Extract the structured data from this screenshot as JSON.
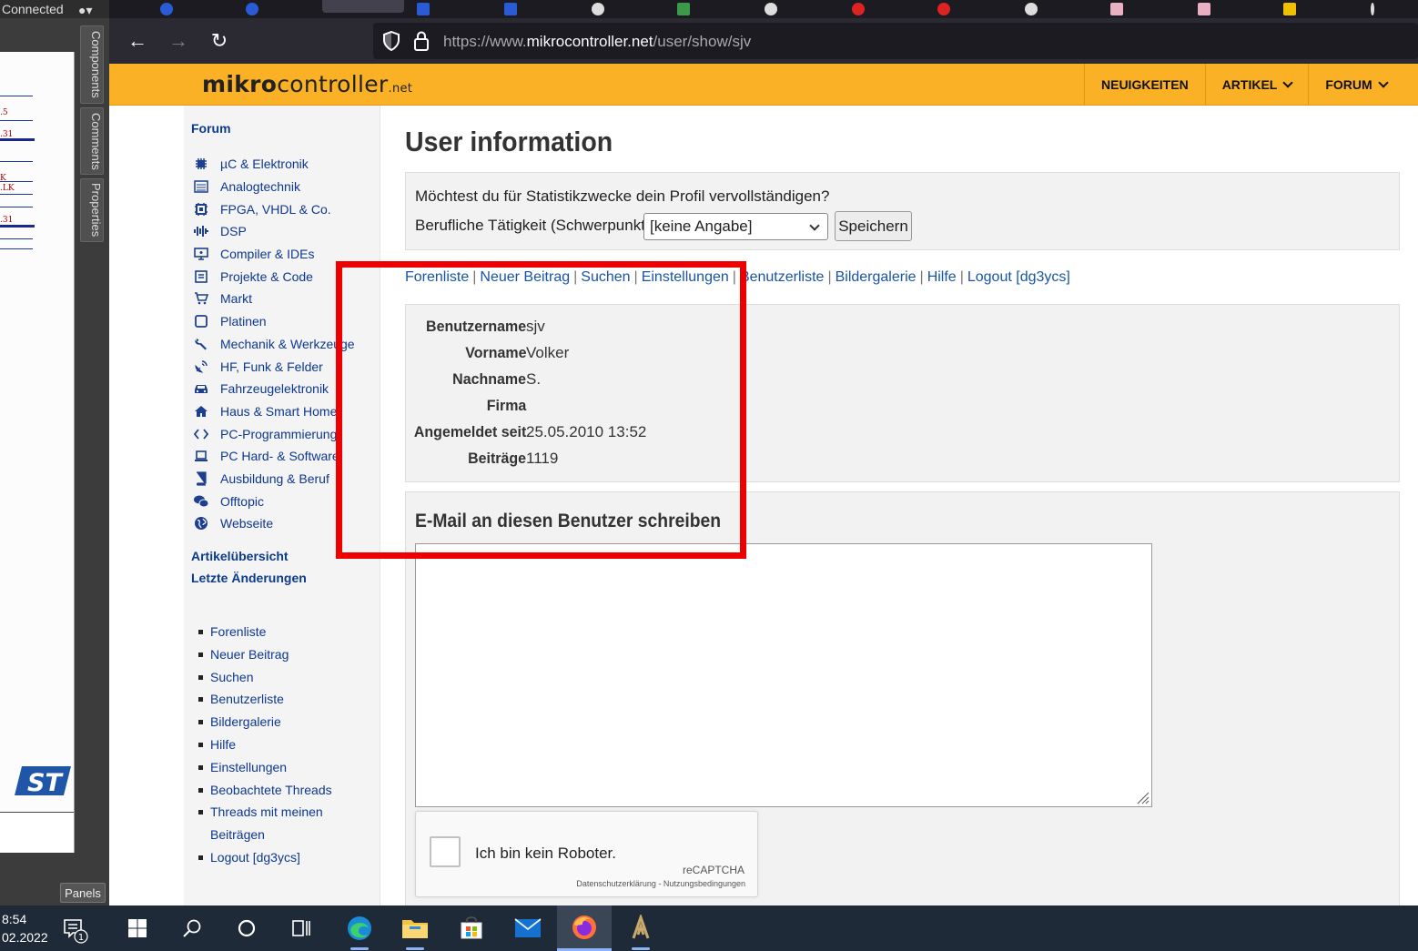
{
  "schematic": {
    "status_text": "Connected",
    "side_tabs": [
      "Components",
      "Comments",
      "Properties"
    ],
    "panels_label": "Panels",
    "labels": [
      ".5",
      ".31",
      "K",
      ".LK",
      ".31"
    ]
  },
  "browser": {
    "url_prefix": "https://www.",
    "url_domain": "mikrocontroller.net",
    "url_path": "/user/show/sjv"
  },
  "site": {
    "logo_bold": "mikro",
    "logo_light": "controller",
    "logo_suffix": ".net",
    "nav": [
      {
        "label": "NEUIGKEITEN"
      },
      {
        "label": "ARTIKEL"
      },
      {
        "label": "FORUM"
      }
    ]
  },
  "sidebar": {
    "forum_heading": "Forum",
    "forum_items": [
      {
        "label": "µC & Elektronik",
        "icon": "chip-icon"
      },
      {
        "label": "Analogtechnik",
        "icon": "analog-icon"
      },
      {
        "label": "FPGA, VHDL & Co.",
        "icon": "fpga-icon"
      },
      {
        "label": "DSP",
        "icon": "waveform-icon"
      },
      {
        "label": "Compiler & IDEs",
        "icon": "monitor-code-icon"
      },
      {
        "label": "Projekte & Code",
        "icon": "project-icon"
      },
      {
        "label": "Markt",
        "icon": "cart-icon"
      },
      {
        "label": "Platinen",
        "icon": "pcb-icon"
      },
      {
        "label": "Mechanik & Werkzeuge",
        "icon": "wrench-icon"
      },
      {
        "label": "HF, Funk & Felder",
        "icon": "satellite-icon"
      },
      {
        "label": "Fahrzeugelektronik",
        "icon": "car-icon"
      },
      {
        "label": "Haus & Smart Home",
        "icon": "house-icon"
      },
      {
        "label": "PC-Programmierung",
        "icon": "code-brackets-icon"
      },
      {
        "label": "PC Hard- & Software",
        "icon": "laptop-icon"
      },
      {
        "label": "Ausbildung & Beruf",
        "icon": "book-icon"
      },
      {
        "label": "Offtopic",
        "icon": "chat-icon"
      },
      {
        "label": "Webseite",
        "icon": "globe-icon"
      }
    ],
    "article_overview": "Artikelübersicht",
    "recent_changes": "Letzte Änderungen",
    "links": [
      "Forenliste",
      "Neuer Beitrag",
      "Suchen",
      "Benutzerliste",
      "Bildergalerie",
      "Hilfe",
      "Einstellungen",
      "Beobachtete Threads",
      "Threads mit meinen",
      "Beiträgen",
      "Logout [dg3ycs]"
    ]
  },
  "main": {
    "title": "User information",
    "profile_prompt": "Möchtest du für Statistikzwecke dein Profil vervollständigen?",
    "job_label": "Berufliche Tätigkeit (Schwerpunkt):",
    "job_value": "[keine Angabe]",
    "save_label": "Speichern",
    "links": [
      "Forenliste",
      "Neuer Beitrag",
      "Suchen",
      "Einstellungen",
      "Benutzerliste",
      "Bildergalerie",
      "Hilfe",
      "Logout [dg3ycs]"
    ],
    "user_info": [
      {
        "key": "Benutzername",
        "value": "sjv"
      },
      {
        "key": "Vorname",
        "value": "Volker"
      },
      {
        "key": "Nachname",
        "value": "S."
      },
      {
        "key": "Firma",
        "value": ""
      },
      {
        "key": "Angemeldet seit",
        "value": "25.05.2010 13:52"
      },
      {
        "key": "Beiträge",
        "value": "1119"
      }
    ],
    "email_heading": "E-Mail an diesen Benutzer schreiben",
    "captcha_label": "Ich bin kein Roboter.",
    "captcha_brand": "reCAPTCHA",
    "captcha_links": "Datenschutzerklärung - Nutzungsbedingungen"
  },
  "taskbar": {
    "time": "8:54",
    "date": "02.2022",
    "notification_count": "1"
  },
  "colors": {
    "header_bg": "#fbb125",
    "link": "#1854a8",
    "annotation": "#ee0000"
  }
}
